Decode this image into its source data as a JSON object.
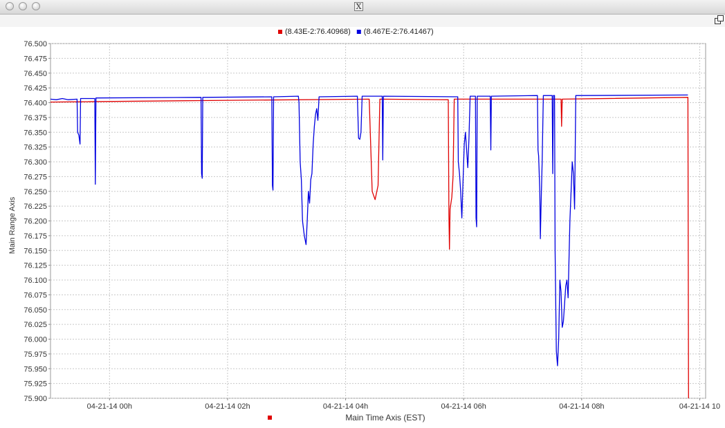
{
  "window": {
    "app_icon_glyph": "X",
    "restore_icon": "restore-window-icon"
  },
  "chart_data": {
    "type": "line",
    "title": "",
    "xlabel": "Main Time Axis (EST)",
    "ylabel": "Main Range Axis",
    "xlim": [
      -1.0,
      10.1
    ],
    "ylim": [
      75.9,
      76.5
    ],
    "grid": true,
    "legend_position": "top-center",
    "y_ticks": [
      "76.500",
      "76.475",
      "76.450",
      "76.425",
      "76.400",
      "76.375",
      "76.350",
      "76.325",
      "76.300",
      "76.275",
      "76.250",
      "76.225",
      "76.200",
      "76.175",
      "76.150",
      "76.125",
      "76.100",
      "76.075",
      "76.050",
      "76.025",
      "76.000",
      "75.975",
      "75.950",
      "75.925",
      "75.900"
    ],
    "x_ticks": [
      {
        "x": 0,
        "label": "04-21-14 00h"
      },
      {
        "x": 2,
        "label": "04-21-14 02h"
      },
      {
        "x": 4,
        "label": "04-21-14 04h"
      },
      {
        "x": 6,
        "label": "04-21-14 06h"
      },
      {
        "x": 8,
        "label": "04-21-14 08h"
      },
      {
        "x": 10,
        "label": "04-21-14 10"
      }
    ],
    "series": [
      {
        "name": "(8.43E-2:76.40968)",
        "color": "#e00000",
        "points": [
          [
            -1.0,
            76.401
          ],
          [
            2.0,
            76.404
          ],
          [
            4.4,
            76.406
          ],
          [
            4.45,
            76.25
          ],
          [
            4.5,
            76.236
          ],
          [
            4.55,
            76.26
          ],
          [
            4.58,
            76.406
          ],
          [
            5.74,
            76.405
          ],
          [
            5.75,
            76.21
          ],
          [
            5.76,
            76.152
          ],
          [
            5.77,
            76.22
          ],
          [
            5.8,
            76.24
          ],
          [
            5.82,
            76.275
          ],
          [
            5.84,
            76.406
          ],
          [
            7.65,
            76.406
          ],
          [
            7.66,
            76.36
          ],
          [
            7.67,
            76.406
          ],
          [
            9.8,
            76.409
          ],
          [
            9.81,
            75.9
          ]
        ]
      },
      {
        "name": "(8.467E-2:76.41467)",
        "color": "#0000e0",
        "points": [
          [
            -1.0,
            76.406
          ],
          [
            -0.9,
            76.405
          ],
          [
            -0.8,
            76.407
          ],
          [
            -0.7,
            76.405
          ],
          [
            -0.55,
            76.406
          ],
          [
            -0.54,
            76.35
          ],
          [
            -0.52,
            76.345
          ],
          [
            -0.5,
            76.33
          ],
          [
            -0.49,
            76.407
          ],
          [
            -0.25,
            76.407
          ],
          [
            -0.24,
            76.262
          ],
          [
            -0.23,
            76.408
          ],
          [
            1.55,
            76.409
          ],
          [
            1.56,
            76.28
          ],
          [
            1.57,
            76.272
          ],
          [
            1.58,
            76.409
          ],
          [
            2.75,
            76.41
          ],
          [
            2.76,
            76.26
          ],
          [
            2.77,
            76.252
          ],
          [
            2.78,
            76.41
          ],
          [
            3.2,
            76.411
          ],
          [
            3.21,
            76.4
          ],
          [
            3.23,
            76.3
          ],
          [
            3.25,
            76.27
          ],
          [
            3.27,
            76.2
          ],
          [
            3.3,
            76.175
          ],
          [
            3.33,
            76.16
          ],
          [
            3.35,
            76.2
          ],
          [
            3.37,
            76.25
          ],
          [
            3.39,
            76.23
          ],
          [
            3.41,
            76.27
          ],
          [
            3.43,
            76.28
          ],
          [
            3.45,
            76.33
          ],
          [
            3.47,
            76.36
          ],
          [
            3.49,
            76.38
          ],
          [
            3.51,
            76.39
          ],
          [
            3.53,
            76.37
          ],
          [
            3.55,
            76.41
          ],
          [
            4.2,
            76.411
          ],
          [
            4.22,
            76.34
          ],
          [
            4.24,
            76.338
          ],
          [
            4.26,
            76.35
          ],
          [
            4.28,
            76.411
          ],
          [
            4.62,
            76.411
          ],
          [
            4.63,
            76.303
          ],
          [
            4.64,
            76.411
          ],
          [
            5.9,
            76.41
          ],
          [
            5.91,
            76.3
          ],
          [
            5.93,
            76.28
          ],
          [
            5.95,
            76.25
          ],
          [
            5.97,
            76.205
          ],
          [
            5.99,
            76.27
          ],
          [
            6.01,
            76.33
          ],
          [
            6.03,
            76.35
          ],
          [
            6.05,
            76.32
          ],
          [
            6.07,
            76.29
          ],
          [
            6.09,
            76.34
          ],
          [
            6.11,
            76.411
          ],
          [
            6.2,
            76.411
          ],
          [
            6.21,
            76.205
          ],
          [
            6.22,
            76.19
          ],
          [
            6.23,
            76.411
          ],
          [
            6.45,
            76.411
          ],
          [
            6.46,
            76.32
          ],
          [
            6.47,
            76.411
          ],
          [
            7.25,
            76.412
          ],
          [
            7.26,
            76.32
          ],
          [
            7.27,
            76.31
          ],
          [
            7.29,
            76.25
          ],
          [
            7.3,
            76.17
          ],
          [
            7.31,
            76.22
          ],
          [
            7.33,
            76.3
          ],
          [
            7.35,
            76.412
          ],
          [
            7.5,
            76.412
          ],
          [
            7.51,
            76.28
          ],
          [
            7.52,
            76.412
          ],
          [
            7.54,
            76.412
          ],
          [
            7.55,
            76.15
          ],
          [
            7.57,
            75.98
          ],
          [
            7.59,
            75.955
          ],
          [
            7.61,
            76.0
          ],
          [
            7.63,
            76.1
          ],
          [
            7.65,
            76.08
          ],
          [
            7.67,
            76.02
          ],
          [
            7.69,
            76.03
          ],
          [
            7.71,
            76.06
          ],
          [
            7.73,
            76.09
          ],
          [
            7.75,
            76.1
          ],
          [
            7.77,
            76.07
          ],
          [
            7.8,
            76.2
          ],
          [
            7.82,
            76.25
          ],
          [
            7.84,
            76.3
          ],
          [
            7.86,
            76.28
          ],
          [
            7.88,
            76.22
          ],
          [
            7.9,
            76.412
          ],
          [
            9.8,
            76.413
          ]
        ]
      }
    ]
  }
}
